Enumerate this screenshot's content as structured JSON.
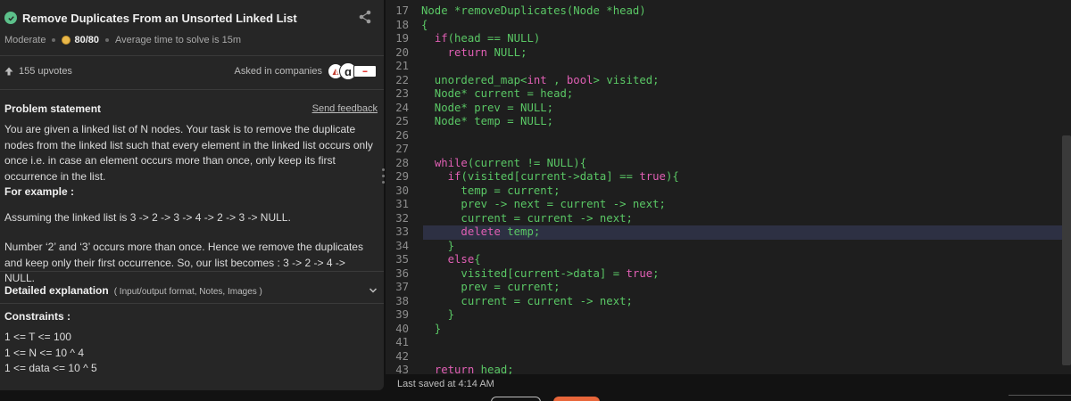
{
  "problem": {
    "title": "Remove Duplicates From an Unsorted Linked List",
    "difficulty": "Moderate",
    "score": "80/80",
    "avg_time": "Average time to solve is 15m",
    "upvotes": "155 upvotes",
    "asked_in": "Asked in companies",
    "company_logos": [
      "amazon-logo",
      "a-logo",
      "company-logo"
    ],
    "statement_title": "Problem statement",
    "send_feedback": "Send feedback",
    "description": "You are given a linked list of N nodes. Your task is to remove the duplicate nodes from the linked list such that every element in the linked list occurs only once i.e. in case an element occurs more than once, only keep its first occurrence in the list.",
    "for_example": "For example :",
    "example_line": "Assuming the linked list is 3 -> 2 -> 3 -> 4 -> 2 -> 3 -> NULL.",
    "explanation": "Number ‘2’ and ‘3’ occurs more than once. Hence we remove the duplicates and keep only their first occurrence. So, our list becomes : 3 -> 2 -> 4 -> NULL.",
    "detailed_title": "Detailed explanation",
    "detailed_sub": "( Input/output format, Notes, Images )",
    "constraints_title": "Constraints :",
    "constraints": [
      "1 <= T <= 100",
      "1 <= N <= 10 ^ 4",
      "1 <= data <= 10 ^ 5"
    ]
  },
  "editor": {
    "active_line": 33,
    "lines": [
      {
        "n": "17",
        "parts": [
          [
            "txt",
            "Node *removeDuplicates(Node *head)"
          ]
        ]
      },
      {
        "n": "18",
        "parts": [
          [
            "txt",
            "{"
          ]
        ]
      },
      {
        "n": "19",
        "parts": [
          [
            "txt",
            "  "
          ],
          [
            "kw",
            "if"
          ],
          [
            "txt",
            "(head == NULL)"
          ]
        ]
      },
      {
        "n": "20",
        "parts": [
          [
            "txt",
            "    "
          ],
          [
            "kw",
            "return"
          ],
          [
            "txt",
            " NULL;"
          ]
        ]
      },
      {
        "n": "21",
        "parts": [
          [
            "txt",
            ""
          ]
        ]
      },
      {
        "n": "22",
        "parts": [
          [
            "txt",
            "  unordered_map<"
          ],
          [
            "kw",
            "int"
          ],
          [
            "txt",
            " , "
          ],
          [
            "kw",
            "bool"
          ],
          [
            "txt",
            "> visited;"
          ]
        ]
      },
      {
        "n": "23",
        "parts": [
          [
            "txt",
            "  Node* current = head;"
          ]
        ]
      },
      {
        "n": "24",
        "parts": [
          [
            "txt",
            "  Node* prev = NULL;"
          ]
        ]
      },
      {
        "n": "25",
        "parts": [
          [
            "txt",
            "  Node* temp = NULL;"
          ]
        ]
      },
      {
        "n": "26",
        "parts": [
          [
            "txt",
            ""
          ]
        ]
      },
      {
        "n": "27",
        "parts": [
          [
            "txt",
            ""
          ]
        ]
      },
      {
        "n": "28",
        "parts": [
          [
            "txt",
            "  "
          ],
          [
            "kw",
            "while"
          ],
          [
            "txt",
            "(current != NULL){"
          ]
        ]
      },
      {
        "n": "29",
        "parts": [
          [
            "txt",
            "    "
          ],
          [
            "kw",
            "if"
          ],
          [
            "txt",
            "(visited[current->data] == "
          ],
          [
            "kw",
            "true"
          ],
          [
            "txt",
            "){"
          ]
        ]
      },
      {
        "n": "30",
        "parts": [
          [
            "txt",
            "      temp = current;"
          ]
        ]
      },
      {
        "n": "31",
        "parts": [
          [
            "txt",
            "      prev -> next = current -> next;"
          ]
        ]
      },
      {
        "n": "32",
        "parts": [
          [
            "txt",
            "      current = current -> next;"
          ]
        ]
      },
      {
        "n": "33",
        "parts": [
          [
            "txt",
            "      "
          ],
          [
            "kw",
            "delete"
          ],
          [
            "txt",
            " temp;"
          ]
        ]
      },
      {
        "n": "34",
        "parts": [
          [
            "txt",
            "    }"
          ]
        ]
      },
      {
        "n": "35",
        "parts": [
          [
            "txt",
            "    "
          ],
          [
            "kw",
            "else"
          ],
          [
            "txt",
            "{"
          ]
        ]
      },
      {
        "n": "36",
        "parts": [
          [
            "txt",
            "      visited[current->data] = "
          ],
          [
            "kw",
            "true"
          ],
          [
            "txt",
            ";"
          ]
        ]
      },
      {
        "n": "37",
        "parts": [
          [
            "txt",
            "      prev = current;"
          ]
        ]
      },
      {
        "n": "38",
        "parts": [
          [
            "txt",
            "      current = current -> next;"
          ]
        ]
      },
      {
        "n": "39",
        "parts": [
          [
            "txt",
            "    }"
          ]
        ]
      },
      {
        "n": "40",
        "parts": [
          [
            "txt",
            "  }"
          ]
        ]
      },
      {
        "n": "41",
        "parts": [
          [
            "txt",
            ""
          ]
        ]
      },
      {
        "n": "42",
        "parts": [
          [
            "txt",
            ""
          ]
        ]
      },
      {
        "n": "43",
        "parts": [
          [
            "txt",
            "  "
          ],
          [
            "kw",
            "return"
          ],
          [
            "txt",
            " head;"
          ]
        ]
      }
    ],
    "last_saved": "Last saved at 4:14 AM"
  },
  "colors": {
    "keyword": "#e05fb4",
    "code_text": "#5ac765",
    "accent_button": "#e8663a",
    "solved_check": "#5cc08a"
  }
}
